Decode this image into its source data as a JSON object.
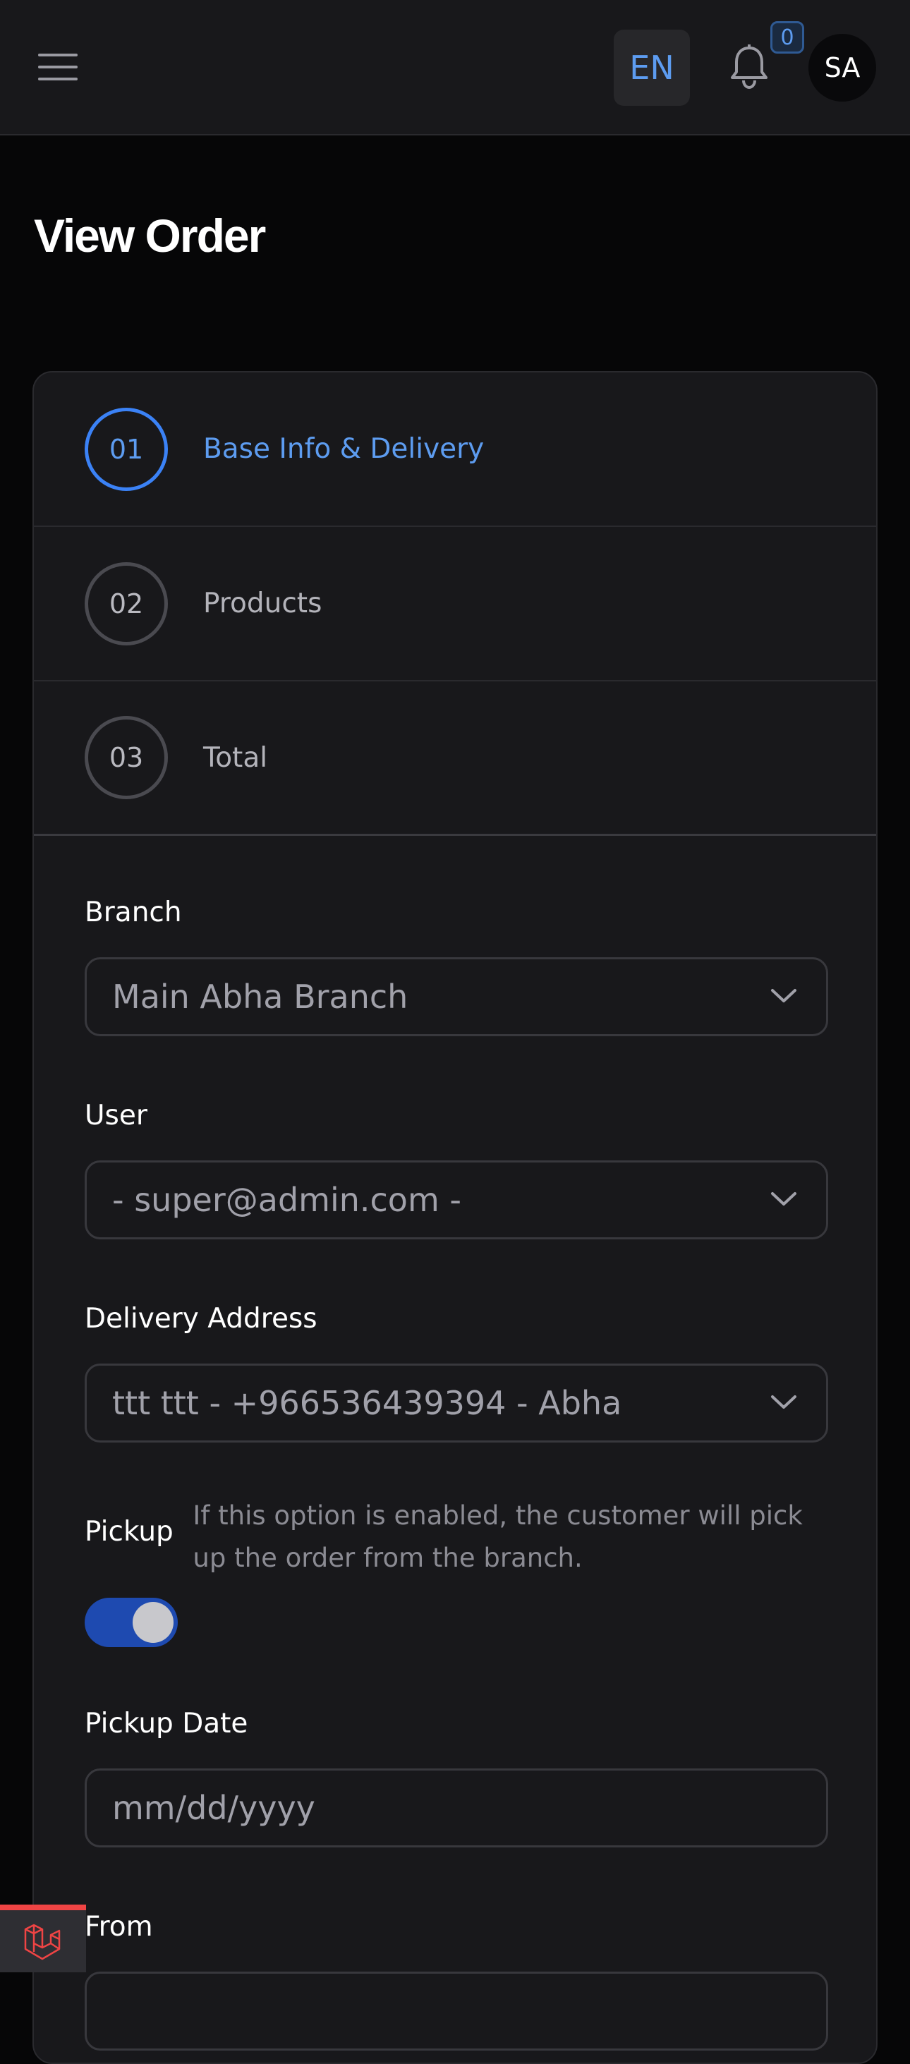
{
  "header": {
    "language": "EN",
    "notification_count": "0",
    "avatar_initials": "SA"
  },
  "page": {
    "title": "View Order"
  },
  "steps": [
    {
      "number": "01",
      "label": "Base Info & Delivery",
      "active": true
    },
    {
      "number": "02",
      "label": "Products",
      "active": false
    },
    {
      "number": "03",
      "label": "Total",
      "active": false
    }
  ],
  "form": {
    "branch": {
      "label": "Branch",
      "value": "Main Abha Branch"
    },
    "user": {
      "label": "User",
      "value": "- super@admin.com -"
    },
    "delivery_address": {
      "label": "Delivery Address",
      "value": "ttt ttt - +966536439394 - Abha"
    },
    "pickup": {
      "label": "Pickup",
      "help": "If this option is enabled, the customer will pick up the order from the branch.",
      "enabled": true
    },
    "pickup_date": {
      "label": "Pickup Date",
      "placeholder": "mm/dd/yyyy"
    },
    "from": {
      "label": "From"
    }
  },
  "colors": {
    "accent": "#3b82f6",
    "toggle_on": "#1e4ab0",
    "laravel_red": "#ef4444"
  }
}
